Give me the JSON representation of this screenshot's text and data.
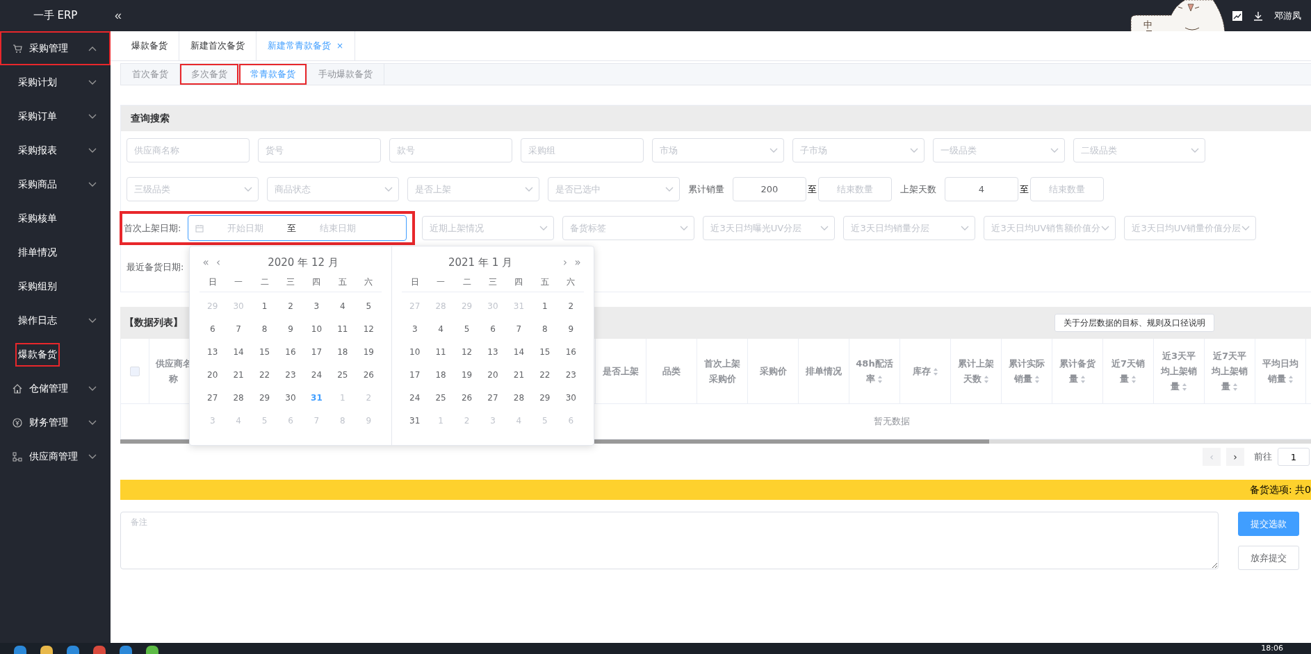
{
  "topbar": {
    "logo": "一手 ERP",
    "collapse": "«",
    "user": "邓游凤",
    "ime_badge": "中"
  },
  "sidebar": {
    "items": [
      {
        "label": "采购管理",
        "kind": "cart",
        "expanded": true,
        "highlighted": true,
        "children": [
          {
            "label": "采购计划",
            "expandable": true,
            "highlighted": false
          },
          {
            "label": "采购订单",
            "expandable": true,
            "highlighted": false
          },
          {
            "label": "采购报表",
            "expandable": true,
            "highlighted": false
          },
          {
            "label": "采购商品",
            "expandable": true,
            "highlighted": false
          },
          {
            "label": "采购核单",
            "expandable": false,
            "highlighted": false
          },
          {
            "label": "排单情况",
            "expandable": false,
            "highlighted": false
          },
          {
            "label": "采购组别",
            "expandable": false,
            "highlighted": false
          },
          {
            "label": "操作日志",
            "expandable": true,
            "highlighted": false
          },
          {
            "label": "爆款备货",
            "expandable": false,
            "highlighted": true
          }
        ]
      },
      {
        "label": "仓储管理",
        "kind": "home",
        "expanded": false,
        "highlighted": false
      },
      {
        "label": "财务管理",
        "kind": "yen",
        "expanded": false,
        "highlighted": false
      },
      {
        "label": "供应商管理",
        "kind": "nodes",
        "expanded": false,
        "highlighted": false
      }
    ]
  },
  "tabs": [
    {
      "label": "爆款备货",
      "selected": false,
      "closable": false
    },
    {
      "label": "新建首次备货",
      "selected": false,
      "closable": false
    },
    {
      "label": "新建常青款备货",
      "selected": true,
      "closable": true,
      "close": "×"
    }
  ],
  "subtabs": [
    {
      "label": "首次备货",
      "selected": false,
      "highlighted": false
    },
    {
      "label": "多次备货",
      "selected": false,
      "highlighted": true
    },
    {
      "label": "常青款备货",
      "selected": true,
      "highlighted": true
    },
    {
      "label": "手动爆款备货",
      "selected": false,
      "highlighted": false
    }
  ],
  "query": {
    "title": "查询搜索",
    "rows": [
      {
        "items": [
          {
            "kind": "input",
            "placeholder": "供应商名称"
          },
          {
            "kind": "input",
            "placeholder": "货号"
          },
          {
            "kind": "input",
            "placeholder": "款号"
          },
          {
            "kind": "input",
            "placeholder": "采购组"
          },
          {
            "kind": "select",
            "placeholder": "市场"
          },
          {
            "kind": "select",
            "placeholder": "子市场"
          },
          {
            "kind": "select",
            "placeholder": "一级品类"
          },
          {
            "kind": "select",
            "placeholder": "二级品类"
          }
        ]
      },
      {
        "items": [
          {
            "kind": "select",
            "placeholder": "三级品类"
          },
          {
            "kind": "select",
            "placeholder": "商品状态"
          },
          {
            "kind": "select",
            "placeholder": "是否上架"
          },
          {
            "kind": "select",
            "placeholder": "是否已选中"
          },
          {
            "kind": "label",
            "text": "累计销量"
          },
          {
            "kind": "number",
            "value": "200"
          },
          {
            "kind": "sep",
            "text": "至"
          },
          {
            "kind": "number",
            "placeholder": "结束数量"
          },
          {
            "kind": "label",
            "text": "上架天数"
          },
          {
            "kind": "number",
            "value": "4"
          },
          {
            "kind": "sep",
            "text": "至"
          },
          {
            "kind": "number",
            "placeholder": "结束数量"
          }
        ]
      },
      {
        "items": [
          {
            "kind": "date_range",
            "label": "首次上架日期:",
            "start": "开始日期",
            "separator": "至",
            "end": "结束日期",
            "highlighted": true
          },
          {
            "kind": "select",
            "placeholder": "近期上架情况"
          },
          {
            "kind": "select",
            "placeholder": "备货标签"
          },
          {
            "kind": "select",
            "placeholder": "近3天日均曝光UV分层"
          },
          {
            "kind": "select",
            "placeholder": "近3天日均销量分层"
          },
          {
            "kind": "select",
            "placeholder": "近3天日均UV销售额价值分"
          },
          {
            "kind": "select",
            "placeholder": "近3天日均UV销量价值分层"
          }
        ]
      },
      {
        "items": [
          {
            "kind": "label",
            "text": "最近备货日期:"
          }
        ]
      }
    ]
  },
  "calendar": {
    "months": [
      {
        "title": "2020 年 12 月",
        "nav_left": [
          "«",
          "‹"
        ],
        "weekdays": [
          "日",
          "一",
          "二",
          "三",
          "四",
          "五",
          "六"
        ],
        "weeks": [
          {
            "days": [
              {
                "d": "29",
                "muted": true,
                "today": false
              },
              {
                "d": "30",
                "muted": true,
                "today": false
              },
              {
                "d": "1",
                "muted": false,
                "today": false
              },
              {
                "d": "2",
                "muted": false,
                "today": false
              },
              {
                "d": "3",
                "muted": false,
                "today": false
              },
              {
                "d": "4",
                "muted": false,
                "today": false
              },
              {
                "d": "5",
                "muted": false,
                "today": false
              }
            ]
          },
          {
            "days": [
              {
                "d": "6",
                "muted": false,
                "today": false
              },
              {
                "d": "7",
                "muted": false,
                "today": false
              },
              {
                "d": "8",
                "muted": false,
                "today": false
              },
              {
                "d": "9",
                "muted": false,
                "today": false
              },
              {
                "d": "10",
                "muted": false,
                "today": false
              },
              {
                "d": "11",
                "muted": false,
                "today": false
              },
              {
                "d": "12",
                "muted": false,
                "today": false
              }
            ]
          },
          {
            "days": [
              {
                "d": "13",
                "muted": false,
                "today": false
              },
              {
                "d": "14",
                "muted": false,
                "today": false
              },
              {
                "d": "15",
                "muted": false,
                "today": false
              },
              {
                "d": "16",
                "muted": false,
                "today": false
              },
              {
                "d": "17",
                "muted": false,
                "today": false
              },
              {
                "d": "18",
                "muted": false,
                "today": false
              },
              {
                "d": "19",
                "muted": false,
                "today": false
              }
            ]
          },
          {
            "days": [
              {
                "d": "20",
                "muted": false,
                "today": false
              },
              {
                "d": "21",
                "muted": false,
                "today": false
              },
              {
                "d": "22",
                "muted": false,
                "today": false
              },
              {
                "d": "23",
                "muted": false,
                "today": false
              },
              {
                "d": "24",
                "muted": false,
                "today": false
              },
              {
                "d": "25",
                "muted": false,
                "today": false
              },
              {
                "d": "26",
                "muted": false,
                "today": false
              }
            ]
          },
          {
            "days": [
              {
                "d": "27",
                "muted": false,
                "today": false
              },
              {
                "d": "28",
                "muted": false,
                "today": false
              },
              {
                "d": "29",
                "muted": false,
                "today": false
              },
              {
                "d": "30",
                "muted": false,
                "today": false
              },
              {
                "d": "31",
                "muted": false,
                "today": true
              },
              {
                "d": "1",
                "muted": true,
                "today": false
              },
              {
                "d": "2",
                "muted": true,
                "today": false
              }
            ]
          },
          {
            "days": [
              {
                "d": "3",
                "muted": true,
                "today": false
              },
              {
                "d": "4",
                "muted": true,
                "today": false
              },
              {
                "d": "5",
                "muted": true,
                "today": false
              },
              {
                "d": "6",
                "muted": true,
                "today": false
              },
              {
                "d": "7",
                "muted": true,
                "today": false
              },
              {
                "d": "8",
                "muted": true,
                "today": false
              },
              {
                "d": "9",
                "muted": true,
                "today": false
              }
            ]
          }
        ]
      },
      {
        "title": "2021 年 1 月",
        "nav_right": [
          "›",
          "»"
        ],
        "weekdays": [
          "日",
          "一",
          "二",
          "三",
          "四",
          "五",
          "六"
        ],
        "weeks": [
          {
            "days": [
              {
                "d": "27",
                "muted": true,
                "today": false
              },
              {
                "d": "28",
                "muted": true,
                "today": false
              },
              {
                "d": "29",
                "muted": true,
                "today": false
              },
              {
                "d": "30",
                "muted": true,
                "today": false
              },
              {
                "d": "31",
                "muted": true,
                "today": false
              },
              {
                "d": "1",
                "muted": false,
                "today": false
              },
              {
                "d": "2",
                "muted": false,
                "today": false
              }
            ]
          },
          {
            "days": [
              {
                "d": "3",
                "muted": false,
                "today": false
              },
              {
                "d": "4",
                "muted": false,
                "today": false
              },
              {
                "d": "5",
                "muted": false,
                "today": false
              },
              {
                "d": "6",
                "muted": false,
                "today": false
              },
              {
                "d": "7",
                "muted": false,
                "today": false
              },
              {
                "d": "8",
                "muted": false,
                "today": false
              },
              {
                "d": "9",
                "muted": false,
                "today": false
              }
            ]
          },
          {
            "days": [
              {
                "d": "10",
                "muted": false,
                "today": false
              },
              {
                "d": "11",
                "muted": false,
                "today": false
              },
              {
                "d": "12",
                "muted": false,
                "today": false
              },
              {
                "d": "13",
                "muted": false,
                "today": false
              },
              {
                "d": "14",
                "muted": false,
                "today": false
              },
              {
                "d": "15",
                "muted": false,
                "today": false
              },
              {
                "d": "16",
                "muted": false,
                "today": false
              }
            ]
          },
          {
            "days": [
              {
                "d": "17",
                "muted": false,
                "today": false
              },
              {
                "d": "18",
                "muted": false,
                "today": false
              },
              {
                "d": "19",
                "muted": false,
                "today": false
              },
              {
                "d": "20",
                "muted": false,
                "today": false
              },
              {
                "d": "21",
                "muted": false,
                "today": false
              },
              {
                "d": "22",
                "muted": false,
                "today": false
              },
              {
                "d": "23",
                "muted": false,
                "today": false
              }
            ]
          },
          {
            "days": [
              {
                "d": "24",
                "muted": false,
                "today": false
              },
              {
                "d": "25",
                "muted": false,
                "today": false
              },
              {
                "d": "26",
                "muted": false,
                "today": false
              },
              {
                "d": "27",
                "muted": false,
                "today": false
              },
              {
                "d": "28",
                "muted": false,
                "today": false
              },
              {
                "d": "29",
                "muted": false,
                "today": false
              },
              {
                "d": "30",
                "muted": false,
                "today": false
              }
            ]
          },
          {
            "days": [
              {
                "d": "31",
                "muted": false,
                "today": false
              },
              {
                "d": "1",
                "muted": true,
                "today": false
              },
              {
                "d": "2",
                "muted": true,
                "today": false
              },
              {
                "d": "3",
                "muted": true,
                "today": false
              },
              {
                "d": "4",
                "muted": true,
                "today": false
              },
              {
                "d": "5",
                "muted": true,
                "today": false
              },
              {
                "d": "6",
                "muted": true,
                "today": false
              }
            ]
          }
        ]
      }
    ]
  },
  "data_list": {
    "title": "【数据列表】",
    "help_button": "关于分层数据的目标、规则及口径说明",
    "columns": [
      {
        "label": "供应商名称",
        "sortable": false
      },
      {
        "label": "是否上架",
        "sortable": false
      },
      {
        "label": "品类",
        "sortable": false
      },
      {
        "label": "首次上架采购价",
        "sortable": false
      },
      {
        "label": "采购价",
        "sortable": false
      },
      {
        "label": "排单情况",
        "sortable": false
      },
      {
        "label": "48h配活率",
        "sortable": true
      },
      {
        "label": "库存",
        "sortable": true
      },
      {
        "label": "累计上架天数",
        "sortable": true
      },
      {
        "label": "累计实际销量",
        "sortable": true
      },
      {
        "label": "累计备货量",
        "sortable": true
      },
      {
        "label": "近7天销量",
        "sortable": true
      },
      {
        "label": "近3天平均上架销量",
        "sortable": true
      },
      {
        "label": "近7天平均上架销量",
        "sortable": true
      },
      {
        "label": "平均日均销量",
        "sortable": true
      }
    ],
    "select_all": {
      "checked": false
    },
    "empty": "暂无数据",
    "prev": {
      "label": "‹",
      "disabled": true
    },
    "next": {
      "label": "›",
      "disabled": false
    },
    "goto_label": "前往",
    "page": "1"
  },
  "selection_bar": {
    "text": "备货选项: 共0"
  },
  "remark": {
    "placeholder": "备注"
  },
  "buttons": [
    {
      "label": "提交选款",
      "kind": "primary"
    },
    {
      "label": "放弃提交",
      "kind": "default"
    }
  ],
  "taskbar": {
    "clock": "18:06"
  }
}
